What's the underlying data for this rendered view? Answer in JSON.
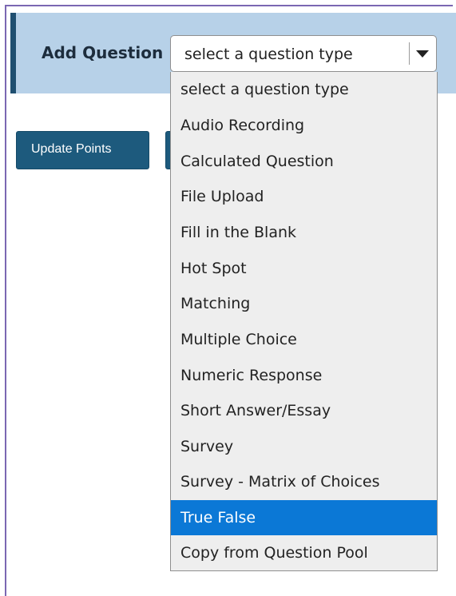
{
  "header": {
    "label": "Add Question"
  },
  "select": {
    "value": "select a question type",
    "icon": "chevron-down-icon"
  },
  "buttons": {
    "update_points": "Update Points"
  },
  "dropdown": {
    "options": [
      "select a question type",
      "Audio Recording",
      "Calculated Question",
      "File Upload",
      "Fill in the Blank",
      "Hot Spot",
      "Matching",
      "Multiple Choice",
      "Numeric Response",
      "Short Answer/Essay",
      "Survey",
      "Survey - Matrix of Choices",
      "True False",
      "Copy from Question Pool"
    ],
    "selected": "True False"
  },
  "colors": {
    "header_bg": "#b7d1e8",
    "header_border": "#1f4f70",
    "button_bg": "#1d5a7d",
    "highlight": "#0b78d6",
    "frame_border": "#7b67b2"
  }
}
